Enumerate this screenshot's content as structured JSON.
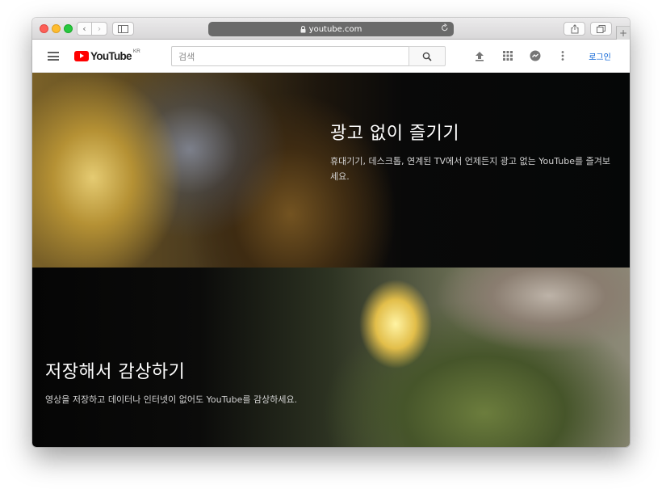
{
  "browser": {
    "url": "youtube.com"
  },
  "header": {
    "logo_text": "YouTube",
    "region": "KR",
    "search_placeholder": "검색",
    "signin_label": "로그인"
  },
  "sections": [
    {
      "title": "광고 없이 즐기기",
      "description": "휴대기기, 데스크톱, 연계된 TV에서 언제든지 광고 없는 YouTube를 즐겨보세요."
    },
    {
      "title": "저장해서 감상하기",
      "description": "영상을 저장하고 데이터나 인터넷이 없어도 YouTube를 감상하세요."
    }
  ],
  "colors": {
    "brand_red": "#ff0000",
    "link_blue": "#065fd4"
  },
  "icons": [
    "menu-icon",
    "upload-icon",
    "apps-icon",
    "messages-icon",
    "more-vert-icon",
    "search-icon",
    "lock-icon",
    "reload-icon"
  ]
}
